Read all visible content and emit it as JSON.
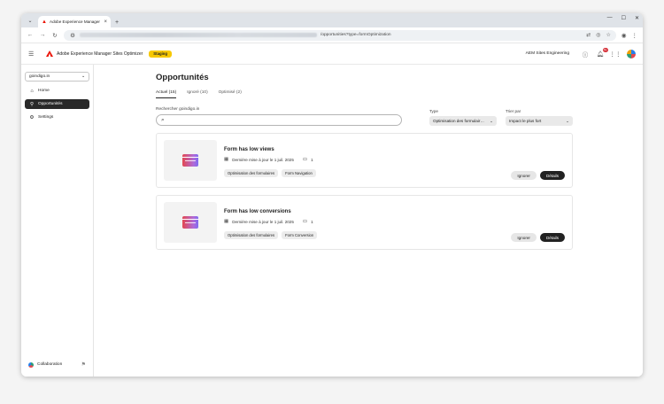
{
  "browser": {
    "tab_title": "Adobe Experience Manager Sit…",
    "url_visible": "/opportunities?type=formOptimization"
  },
  "header": {
    "app_name": "Adobe Experience Manager Sites Optimizer",
    "env_badge": "Staging",
    "org_name": "AEM Sites Engineering",
    "notification_count": "9+"
  },
  "sidebar": {
    "site": "goindigo.in",
    "items": [
      {
        "label": "Home",
        "icon": "home-icon"
      },
      {
        "label": "Opportunités",
        "icon": "opportunities-icon"
      },
      {
        "label": "Settings",
        "icon": "gear-icon"
      }
    ],
    "footer": "Collaboration"
  },
  "main": {
    "title": "Opportunités",
    "tabs": [
      {
        "label": "Actuel (15)",
        "active": true
      },
      {
        "label": "Ignoré (10)",
        "active": false
      },
      {
        "label": "Optimisé (2)",
        "active": false
      }
    ],
    "search_label": "Rechercher goindigo.in",
    "search_placeholder": "",
    "type_label": "Type",
    "type_value": "Optimisation des formulair…",
    "sort_label": "Trier par",
    "sort_value": "Impact le plus fort",
    "cards": [
      {
        "title": "Form has low views",
        "updated": "Dernière mise à jour le 1 juil. 2025",
        "count": "1",
        "tags": [
          "Optimisation des formulaires",
          "Form Navigation"
        ],
        "ignore": "Ignorer",
        "details": "Détails"
      },
      {
        "title": "Form has low conversions",
        "updated": "Dernière mise à jour le 1 juil. 2025",
        "count": "1",
        "tags": [
          "Optimisation des formulaires",
          "Form Conversion"
        ],
        "ignore": "Ignorer",
        "details": "Détails"
      }
    ]
  },
  "colors": {
    "accent": "#292929",
    "staging": "#f7c800",
    "adobe_red": "#eb1000"
  }
}
